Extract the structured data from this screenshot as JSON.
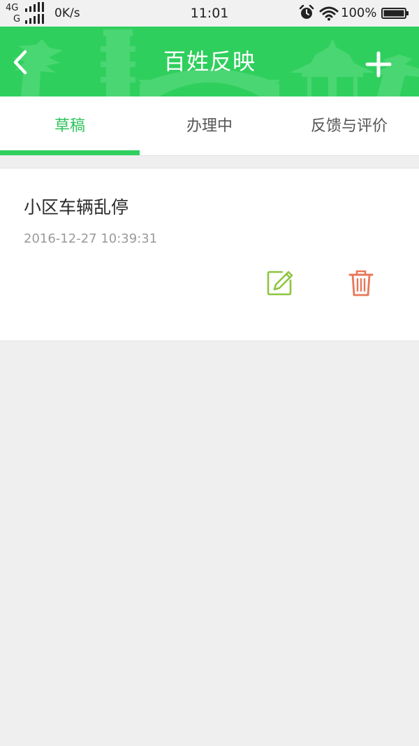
{
  "status_bar": {
    "network_top": "4G",
    "network_bottom": "G",
    "speed": "0K/s",
    "time": "11:01",
    "battery_percent": "100%",
    "icons": [
      "signal-icon",
      "alarm-icon",
      "wifi-icon",
      "battery-icon"
    ]
  },
  "header": {
    "title": "百姓反映",
    "back_icon": "chevron-left-icon",
    "add_icon": "plus-icon",
    "background_color": "#2fcf5d"
  },
  "tabs": [
    {
      "label": "草稿",
      "active": true
    },
    {
      "label": "办理中",
      "active": false
    },
    {
      "label": "反馈与评价",
      "active": false
    }
  ],
  "drafts": [
    {
      "title": "小区车辆乱停",
      "time": "2016-12-27 10:39:31",
      "edit_icon": "edit-icon",
      "delete_icon": "trash-icon"
    }
  ],
  "colors": {
    "accent": "#2fcf5d",
    "active_tab_text": "#2fc35b",
    "edit_icon": "#8cc63f",
    "delete_icon": "#e8775a"
  }
}
